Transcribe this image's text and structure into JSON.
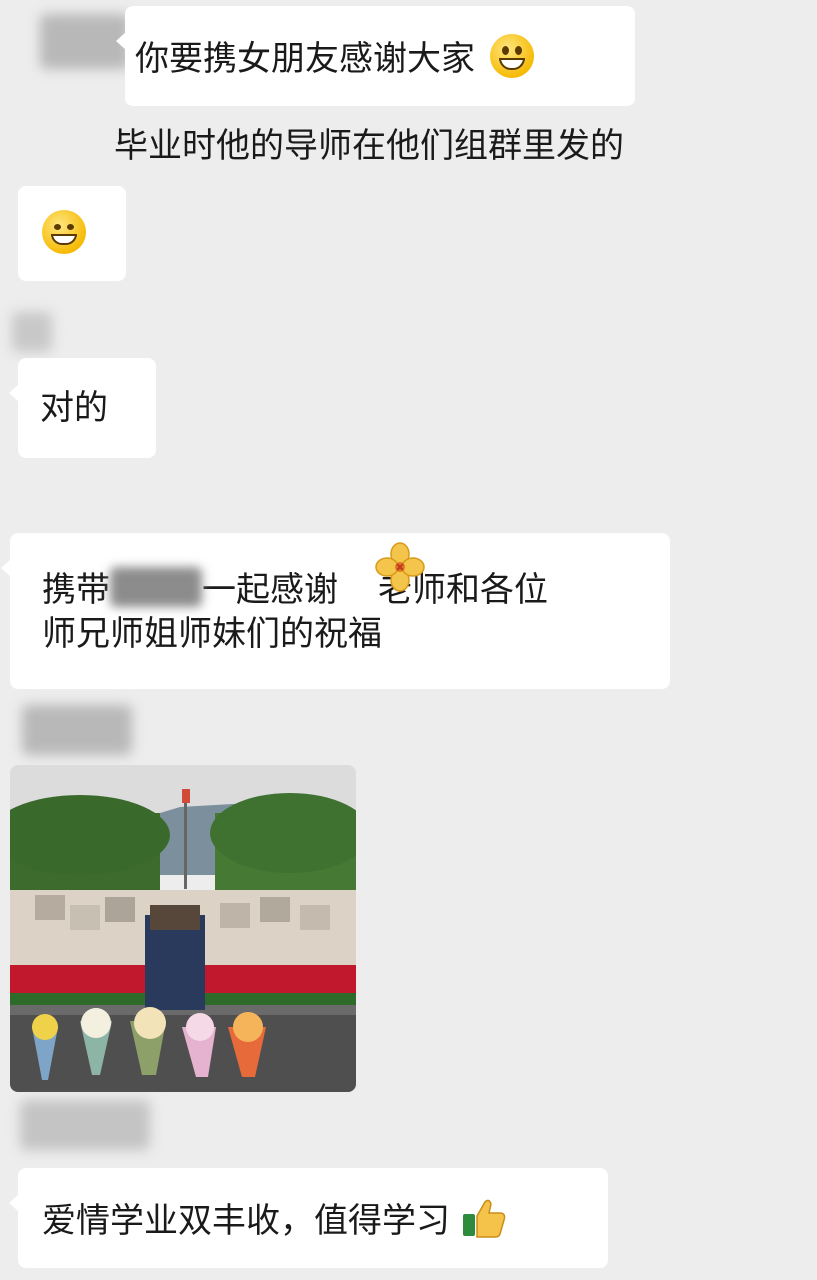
{
  "chat": {
    "messages": [
      {
        "type": "text",
        "text": "你要携女朋友感谢大家",
        "emoji": "grinning-emoji"
      },
      {
        "type": "text",
        "text": "毕业时他的导师在他们组群里发的"
      },
      {
        "type": "emoji",
        "emoji": "smiling-emoji"
      },
      {
        "type": "text",
        "text": "对的"
      },
      {
        "type": "text",
        "line1_a": "携带",
        "line1_b": "一起感谢",
        "line1_c": "老师和各位",
        "line2": "师兄师姐师妹们的祝福"
      },
      {
        "type": "image",
        "image_name": "graduation-photo"
      },
      {
        "type": "text",
        "text": "爱情学业双丰收，值得学习",
        "emoji": "thumbs-up-emoji"
      }
    ]
  },
  "colors": {
    "background": "#ededed",
    "bubble": "#ffffff",
    "emoji": "#f5b800"
  }
}
